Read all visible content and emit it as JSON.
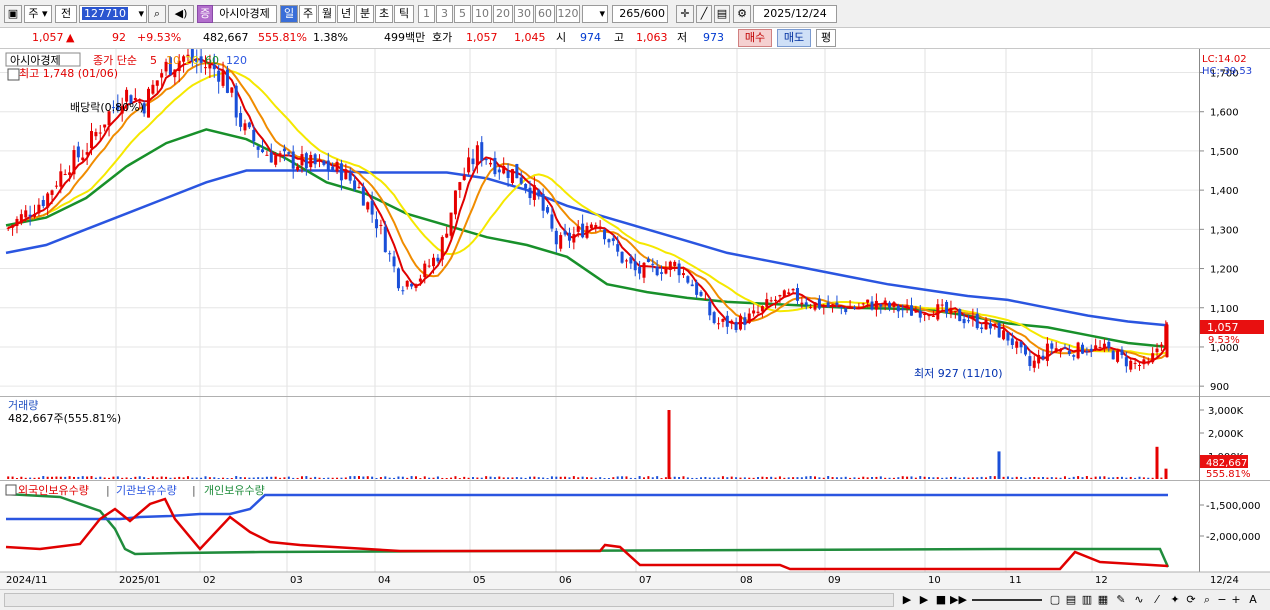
{
  "toolbar": {
    "market": "주",
    "period_type": "전",
    "code": "127710",
    "stock_name": "아시아경제",
    "badge": "증",
    "tabs": [
      "일",
      "주",
      "월",
      "년",
      "분",
      "초",
      "틱"
    ],
    "intervals": [
      "1",
      "3",
      "5",
      "10",
      "20",
      "30",
      "60",
      "120"
    ],
    "count": "265",
    "total": "/600",
    "date": "2025/12/24"
  },
  "quote": {
    "price": "1,057",
    "arrow": "▲",
    "change": "92",
    "rate": "+9.53%",
    "volume": "482,667",
    "volume_rate": "555.81%",
    "turnover": "1.38%",
    "amount": "499백만",
    "ask_bid_label": "호가",
    "ask": "1,057",
    "bid": "1,045",
    "open_label": "시",
    "open": "974",
    "high_label": "고",
    "high": "1,063",
    "low_label": "저",
    "low": "973",
    "buy_label": "매수",
    "sell_label": "매도",
    "avg_label": "평"
  },
  "price_panel": {
    "stock_label": "아시아경제",
    "legend_prefix": "종가 단순",
    "ma_periods": [
      "5",
      "10",
      "20",
      "60",
      "120"
    ],
    "high_note": "최고 1,748 (01/06)",
    "dividend_note": "배당락(0.80%)",
    "low_note": "최저 927 (11/10)",
    "lc": "LC:14.02",
    "hc": "HC:-39.53",
    "current_price": "1,057",
    "current_rate": "9.53%",
    "y_ticks": [
      "1,700",
      "1,600",
      "1,500",
      "1,400",
      "1,300",
      "1,200",
      "1,100",
      "1,000",
      "900"
    ]
  },
  "volume_panel": {
    "title": "거래량",
    "value": "482,667주(555.81%)",
    "y_ticks": [
      "3,000K",
      "2,000K",
      "1,000K"
    ],
    "current": "482,667",
    "current_rate": "555.81%"
  },
  "holdings_panel": {
    "legend": [
      "외국인보유수량",
      "기관보유수량",
      "개인보유수량"
    ],
    "y_ticks": [
      "-1,500,000",
      "-2,000,000"
    ]
  },
  "x_axis": [
    "2024/11",
    "2025/01",
    "02",
    "03",
    "04",
    "05",
    "06",
    "07",
    "08",
    "09",
    "10",
    "11",
    "12",
    "12/24"
  ],
  "colors": {
    "up": "#e60000",
    "down": "#1a4fd8",
    "ma5": "#e00000",
    "ma10": "#f08c00",
    "ma20": "#f5e800",
    "ma60": "#18902a",
    "ma120": "#2a55e0",
    "foreign": "#e00000",
    "inst": "#2a55e0",
    "indiv": "#208c3c"
  },
  "chart_data": {
    "type": "candlestick",
    "ylim": [
      880,
      1760
    ],
    "range": {
      "first": "2024/11",
      "last": "2025/12/24"
    },
    "close_points": [
      1300,
      1340,
      1380,
      1460,
      1500,
      1580,
      1650,
      1620,
      1710,
      1740,
      1720,
      1700,
      1560,
      1500,
      1480,
      1470,
      1460,
      1450,
      1400,
      1300,
      1160,
      1180,
      1240,
      1420,
      1500,
      1460,
      1440,
      1380,
      1260,
      1290,
      1330,
      1240,
      1190,
      1200,
      1210,
      1150,
      1060,
      1060,
      1080,
      1120,
      1130,
      1110,
      1100,
      1100,
      1110,
      1100,
      1090,
      1100,
      1080,
      1070,
      1050,
      1020,
      950,
      1000,
      990,
      1000,
      990,
      960,
      950,
      1057
    ],
    "ma120_points": [
      1240,
      1260,
      1300,
      1340,
      1380,
      1420,
      1450,
      1450,
      1450,
      1445,
      1445,
      1445,
      1430,
      1400,
      1360,
      1330,
      1300,
      1270,
      1240,
      1220,
      1200,
      1180,
      1160,
      1145,
      1130,
      1120,
      1100,
      1080,
      1065,
      1055
    ],
    "ma60_points": [
      1310,
      1330,
      1380,
      1460,
      1520,
      1555,
      1530,
      1480,
      1420,
      1390,
      1340,
      1310,
      1280,
      1260,
      1230,
      1160,
      1140,
      1125,
      1115,
      1110,
      1105,
      1100,
      1098,
      1095,
      1080,
      1060,
      1050,
      1030,
      1010,
      1000
    ],
    "volume_spikes_k": [
      {
        "date": "2025/07",
        "v": 3000
      },
      {
        "date": "2025/10/31",
        "v": 1200
      },
      {
        "date": "2025/12/24",
        "v": 1400
      }
    ]
  }
}
